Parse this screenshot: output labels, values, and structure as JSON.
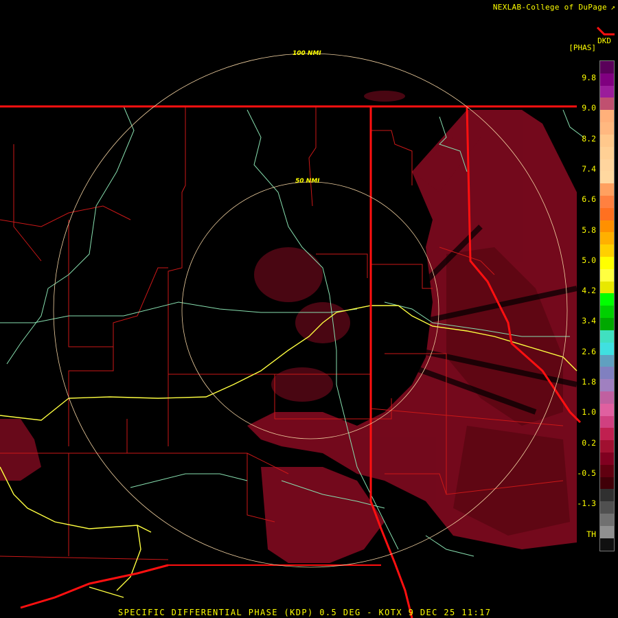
{
  "header": {
    "credit": "NEXLAB-College of DuPage",
    "credit_icon": "external-link-icon",
    "product_code": "DKD",
    "units": "[PHAS]"
  },
  "footer": {
    "caption": "SPECIFIC DIFFERENTIAL PHASE (KDP) 0.5 DEG - KOTX 9 DEC 25 11:17"
  },
  "range_rings": {
    "inner": "50 NMI",
    "outer": "100 NMI"
  },
  "colorbar": {
    "ticks": [
      "9.8",
      "9.0",
      "8.2",
      "7.4",
      "6.6",
      "5.8",
      "5.0",
      "4.2",
      "3.4",
      "2.6",
      "1.8",
      "1.0",
      "0.2",
      "-0.5",
      "-1.3",
      "TH"
    ],
    "colors": [
      "#5a005a",
      "#800080",
      "#9b1d9b",
      "#c05070",
      "#ffb07a",
      "#ffb880",
      "#ffc88c",
      "#ffd095",
      "#ffd59e",
      "#ffd8a0",
      "#ffa060",
      "#ff8040",
      "#ff7020",
      "#ff9000",
      "#ffb000",
      "#ffd000",
      "#ffff00",
      "#ffff40",
      "#e8e800",
      "#00ff00",
      "#00d000",
      "#00a800",
      "#40e0c0",
      "#40e0e0",
      "#60a0c0",
      "#8080c0",
      "#a080c0",
      "#c060a0",
      "#e060a0",
      "#d04080",
      "#c02050",
      "#a01030",
      "#800020",
      "#600010",
      "#400008",
      "#303030",
      "#505050",
      "#707070",
      "#909090",
      "#101010"
    ]
  },
  "map": {
    "colors": {
      "background": "#000000",
      "state_border": "#ff1010",
      "county_border": "#cc1818",
      "highway": "#ffff40",
      "river": "#88e0b0",
      "range_ring": "#f0d0a0",
      "echo_primary": "#7a0a1e",
      "echo_secondary": "#6a0818"
    }
  }
}
